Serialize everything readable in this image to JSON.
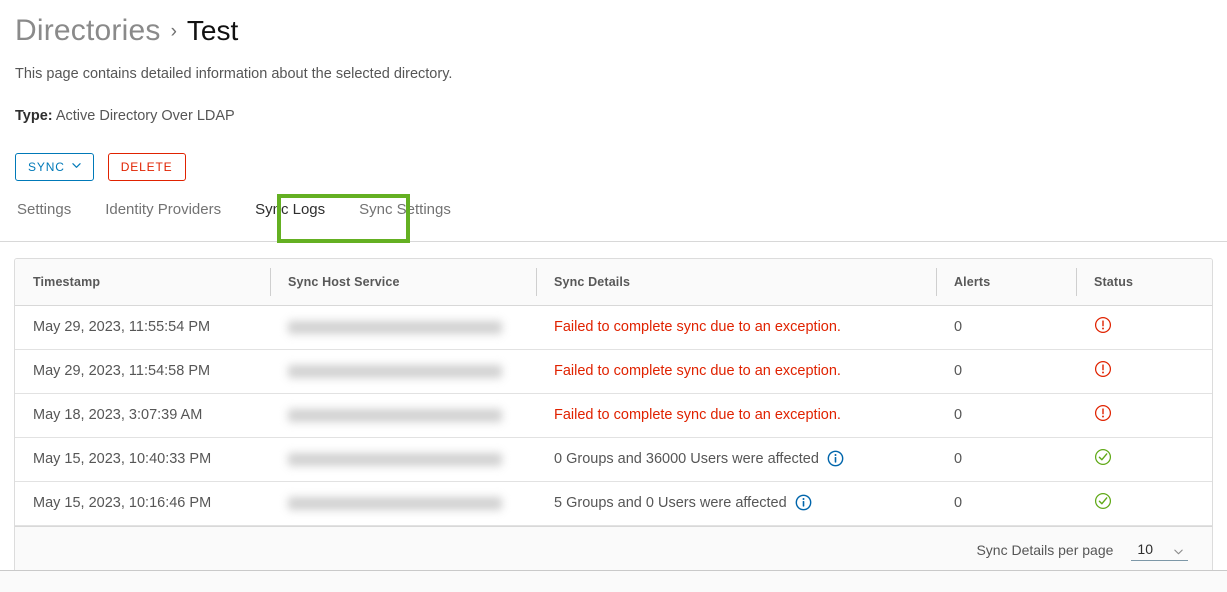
{
  "breadcrumb": {
    "parent": "Directories",
    "separator": "›",
    "current": "Test"
  },
  "subtitle": "This page contains detailed information about the selected directory.",
  "type_row": {
    "label": "Type:",
    "value": "Active Directory Over LDAP"
  },
  "actions": {
    "sync_label": "SYNC",
    "sync_icon": "chevron-down-icon",
    "sync_color": "#0079b8",
    "delete_label": "DELETE",
    "delete_color": "#e02200"
  },
  "tabs": {
    "active_index": 2,
    "highlight_color": "#64b022",
    "items": [
      {
        "label": "Settings"
      },
      {
        "label": "Identity Providers"
      },
      {
        "label": "Sync Logs"
      },
      {
        "label": "Sync Settings"
      }
    ]
  },
  "table": {
    "columns": [
      {
        "label": "Timestamp"
      },
      {
        "label": "Sync Host Service"
      },
      {
        "label": "Sync Details"
      },
      {
        "label": "Alerts"
      },
      {
        "label": "Status"
      }
    ],
    "rows": [
      {
        "timestamp": "May 29, 2023, 11:55:54 PM",
        "host": "",
        "host_redacted": true,
        "details": "Failed to complete sync due to an exception.",
        "details_state": "error",
        "has_info_icon": false,
        "alerts": "0",
        "status": "error",
        "status_icon": "error-circle-icon"
      },
      {
        "timestamp": "May 29, 2023, 11:54:58 PM",
        "host": "",
        "host_redacted": true,
        "details": "Failed to complete sync due to an exception.",
        "details_state": "error",
        "has_info_icon": false,
        "alerts": "0",
        "status": "error",
        "status_icon": "error-circle-icon"
      },
      {
        "timestamp": "May 18, 2023, 3:07:39 AM",
        "host": "",
        "host_redacted": true,
        "details": "Failed to complete sync due to an exception.",
        "details_state": "error",
        "has_info_icon": false,
        "alerts": "0",
        "status": "error",
        "status_icon": "error-circle-icon"
      },
      {
        "timestamp": "May 15, 2023, 10:40:33 PM",
        "host": "",
        "host_redacted": true,
        "details": "0 Groups and 36000 Users were affected",
        "details_state": "ok",
        "has_info_icon": true,
        "alerts": "0",
        "status": "success",
        "status_icon": "success-check-circle-icon"
      },
      {
        "timestamp": "May 15, 2023, 10:16:46 PM",
        "host": "",
        "host_redacted": true,
        "details": "5 Groups and 0 Users were affected",
        "details_state": "ok",
        "has_info_icon": true,
        "alerts": "0",
        "status": "success",
        "status_icon": "success-check-circle-icon"
      }
    ]
  },
  "pagination": {
    "label": "Sync Details per page",
    "value": "10",
    "chevron_icon": "chevron-down-icon"
  },
  "colors": {
    "error": "#e02200",
    "success": "#60a917",
    "info": "#0065ab",
    "link": "#0079b8",
    "annotation": "#64b022"
  }
}
